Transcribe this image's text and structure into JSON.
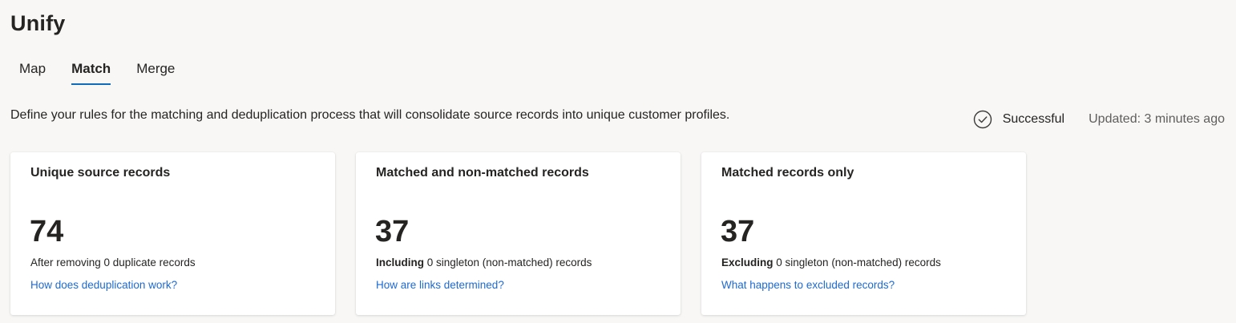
{
  "header": {
    "title": "Unify"
  },
  "tabs": [
    {
      "label": "Map",
      "active": false
    },
    {
      "label": "Match",
      "active": true
    },
    {
      "label": "Merge",
      "active": false
    }
  ],
  "description": "Define your rules for the matching and deduplication process that will consolidate source records into unique customer profiles.",
  "status": {
    "icon": "check-circle-icon",
    "text": "Successful",
    "updated": "Updated: 3 minutes ago"
  },
  "cards": [
    {
      "title": "Unique source records",
      "value": "74",
      "desc_bold": "",
      "desc_text": "After removing 0 duplicate records",
      "link": "How does deduplication work?"
    },
    {
      "title": "Matched and non-matched records",
      "value": "37",
      "desc_bold": "Including",
      "desc_text": " 0 singleton (non-matched) records",
      "link": "How are links determined?"
    },
    {
      "title": "Matched records only",
      "value": "37",
      "desc_bold": "Excluding",
      "desc_text": " 0 singleton (non-matched) records",
      "link": "What happens to excluded records?"
    }
  ],
  "colors": {
    "background": "#f8f7f6",
    "accent": "#0f6cbd",
    "link": "#1e6ad1",
    "muted": "#605e5c"
  }
}
